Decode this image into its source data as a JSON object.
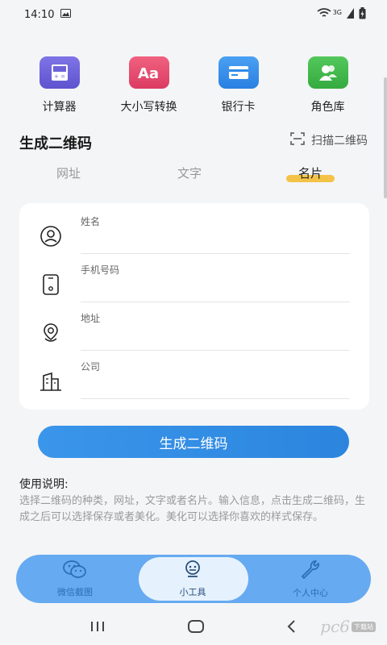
{
  "status_bar": {
    "time": "14:10",
    "network": "3G"
  },
  "tools": [
    {
      "label": "计算器",
      "icon": "calculator-icon",
      "color": "#6d62d8"
    },
    {
      "label": "大小写转换",
      "icon": "font-case-icon",
      "color": "#e8496f"
    },
    {
      "label": "银行卡",
      "icon": "bank-card-icon",
      "color": "#2f8bea"
    },
    {
      "label": "角色库",
      "icon": "people-icon",
      "color": "#3fb84a"
    }
  ],
  "section": {
    "title": "生成二维码",
    "scan_label": "扫描二维码"
  },
  "tabs": [
    {
      "label": "网址",
      "active": false
    },
    {
      "label": "文字",
      "active": false
    },
    {
      "label": "名片",
      "active": true
    }
  ],
  "form": {
    "fields": [
      {
        "label": "姓名",
        "value": "",
        "icon": "user-icon"
      },
      {
        "label": "手机号码",
        "value": "",
        "icon": "phone-icon"
      },
      {
        "label": "地址",
        "value": "",
        "icon": "location-icon"
      },
      {
        "label": "公司",
        "value": "",
        "icon": "building-icon"
      }
    ]
  },
  "generate_label": "生成二维码",
  "usage": {
    "title": "使用说明:",
    "text": "选择二维码的种类，网址，文字或者名片。输入信息，点击生成二维码，生成之后可以选择保存或者美化。美化可以选择你喜欢的样式保存。"
  },
  "bottom_nav": [
    {
      "label": "微信截图",
      "icon": "wechat-icon",
      "active": false
    },
    {
      "label": "小工具",
      "icon": "robot-icon",
      "active": true
    },
    {
      "label": "个人中心",
      "icon": "wrench-icon",
      "active": false
    }
  ],
  "accent": "#2b85de",
  "tab_highlight": "#f4c246",
  "watermark": {
    "text": "pc6",
    "badge": "下载站"
  }
}
